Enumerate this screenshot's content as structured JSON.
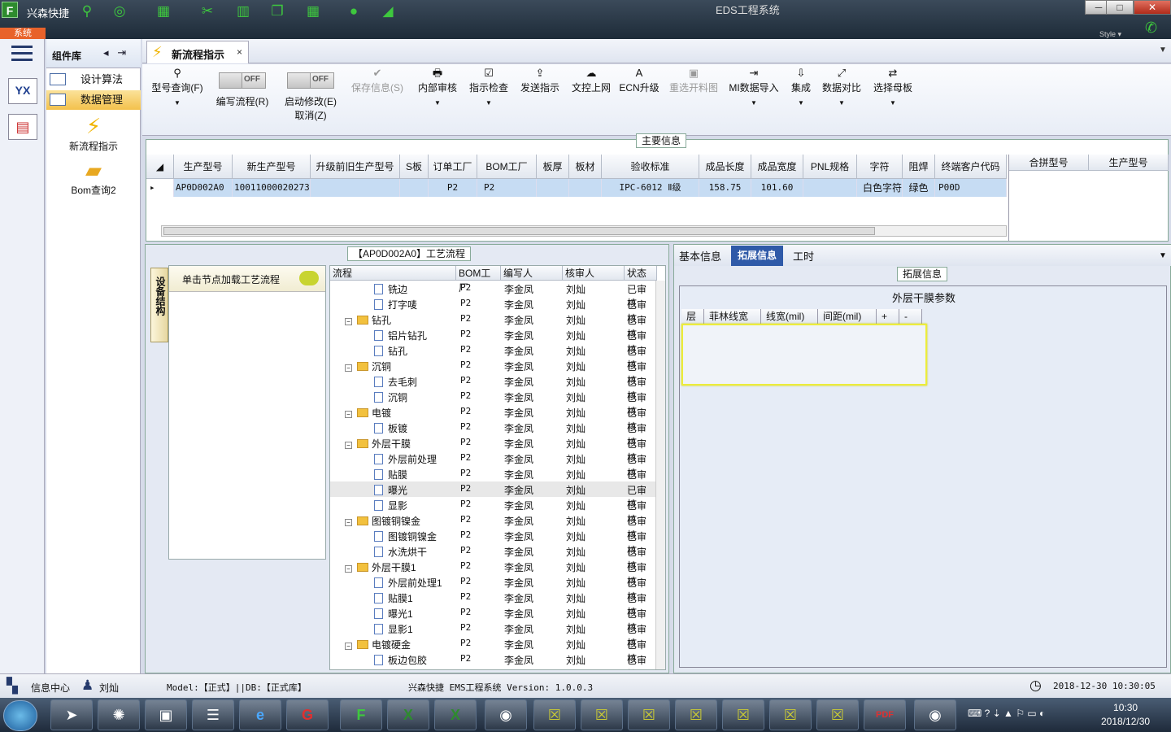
{
  "titlebar": {
    "app_name": "兴森快捷",
    "window_title": "EDS工程系统",
    "sys_tab": "系统",
    "style_label": "Style ▾",
    "min": "─",
    "max": "□",
    "close": "✕"
  },
  "complib": {
    "title": "组件库",
    "items": [
      {
        "label": "设计算法"
      },
      {
        "label": "数据管理"
      }
    ],
    "big_items": [
      {
        "label": "新流程指示"
      },
      {
        "label": "Bom查询2"
      }
    ]
  },
  "leftnav": {
    "yx_label": "YX"
  },
  "tab": {
    "label": "新流程指示",
    "close": "×"
  },
  "toolbar": {
    "buttons": [
      {
        "label": "型号查询(F)",
        "icon": "search-icon",
        "glyph": "🔍"
      },
      {
        "label": "编写流程(R)",
        "toggle": "OFF"
      },
      {
        "label": "启动修改(E)",
        "label2": "取消(Z)",
        "toggle": "OFF"
      },
      {
        "label": "保存信息(S)",
        "glyph": "✔"
      },
      {
        "label": "内部审核",
        "glyph": "🖶"
      },
      {
        "label": "指示检查",
        "glyph": "☑"
      },
      {
        "label": "发送指示",
        "glyph": "⇪"
      },
      {
        "label": "文控上网",
        "glyph": "☁"
      },
      {
        "label": "ECN升级",
        "glyph": "A"
      },
      {
        "label": "重选开料图",
        "glyph": "▣"
      },
      {
        "label": "MI数据导入",
        "glyph": "⇥"
      },
      {
        "label": "集成",
        "glyph": "⇩"
      },
      {
        "label": "数据对比",
        "glyph": "⤢"
      },
      {
        "label": "选择母板",
        "glyph": "⇄"
      }
    ]
  },
  "main_info": {
    "title": "主要信息",
    "columns": [
      "生产型号",
      "新生产型号",
      "升级前旧生产型号",
      "S板",
      "订单工厂",
      "BOM工厂",
      "板厚",
      "板材",
      "验收标准",
      "成品长度",
      "成品宽度",
      "PNL规格",
      "字符",
      "阻焊",
      "终端客户代码"
    ],
    "row": [
      "AP0D002A0",
      "10011000020273",
      "",
      "",
      "P2",
      "P2",
      "",
      "",
      "IPC-6012 Ⅱ级",
      "158.75",
      "101.60",
      "",
      "白色字符",
      "绿色",
      "P00D"
    ],
    "merge_columns": [
      "合拼型号",
      "生产型号"
    ]
  },
  "flow": {
    "title": "【AP0D002A0】工艺流程",
    "side_tab": "设备结构",
    "node_label": "单击节点加载工艺流程",
    "columns": [
      "流程",
      "BOM工厂",
      "编写人",
      "核审人",
      "状态"
    ],
    "rows": [
      {
        "name": "铣边",
        "type": "file",
        "bom": "P2",
        "writer": "李金凤",
        "reviewer": "刘灿",
        "status": "已审核"
      },
      {
        "name": "打字唛",
        "type": "file",
        "bom": "P2",
        "writer": "李金凤",
        "reviewer": "刘灿",
        "status": "已审核"
      },
      {
        "name": "钻孔",
        "type": "folder",
        "bom": "P2",
        "writer": "李金凤",
        "reviewer": "刘灿",
        "status": "已审核"
      },
      {
        "name": "铝片钻孔",
        "type": "file",
        "bom": "P2",
        "writer": "李金凤",
        "reviewer": "刘灿",
        "status": "已审核"
      },
      {
        "name": "钻孔",
        "type": "file",
        "bom": "P2",
        "writer": "李金凤",
        "reviewer": "刘灿",
        "status": "已审核"
      },
      {
        "name": "沉铜",
        "type": "folder",
        "bom": "P2",
        "writer": "李金凤",
        "reviewer": "刘灿",
        "status": "已审核"
      },
      {
        "name": "去毛刺",
        "type": "file",
        "bom": "P2",
        "writer": "李金凤",
        "reviewer": "刘灿",
        "status": "已审核"
      },
      {
        "name": "沉铜",
        "type": "file",
        "bom": "P2",
        "writer": "李金凤",
        "reviewer": "刘灿",
        "status": "已审核"
      },
      {
        "name": "电镀",
        "type": "folder",
        "bom": "P2",
        "writer": "李金凤",
        "reviewer": "刘灿",
        "status": "已审核"
      },
      {
        "name": "板镀",
        "type": "file",
        "bom": "P2",
        "writer": "李金凤",
        "reviewer": "刘灿",
        "status": "已审核"
      },
      {
        "name": "外层干膜",
        "type": "folder",
        "bom": "P2",
        "writer": "李金凤",
        "reviewer": "刘灿",
        "status": "已审核"
      },
      {
        "name": "外层前处理",
        "type": "file",
        "bom": "P2",
        "writer": "李金凤",
        "reviewer": "刘灿",
        "status": "已审核"
      },
      {
        "name": "贴膜",
        "type": "file",
        "bom": "P2",
        "writer": "李金凤",
        "reviewer": "刘灿",
        "status": "已审核"
      },
      {
        "name": "曝光",
        "type": "file",
        "bom": "P2",
        "writer": "李金凤",
        "reviewer": "刘灿",
        "status": "已审核",
        "selected": true
      },
      {
        "name": "显影",
        "type": "file",
        "bom": "P2",
        "writer": "李金凤",
        "reviewer": "刘灿",
        "status": "已审核"
      },
      {
        "name": "图镀铜镍金",
        "type": "folder",
        "bom": "P2",
        "writer": "李金凤",
        "reviewer": "刘灿",
        "status": "已审核"
      },
      {
        "name": "图镀铜镍金",
        "type": "file",
        "bom": "P2",
        "writer": "李金凤",
        "reviewer": "刘灿",
        "status": "已审核"
      },
      {
        "name": "水洗烘干",
        "type": "file",
        "bom": "P2",
        "writer": "李金凤",
        "reviewer": "刘灿",
        "status": "已审核"
      },
      {
        "name": "外层干膜1",
        "type": "folder",
        "bom": "P2",
        "writer": "李金凤",
        "reviewer": "刘灿",
        "status": "已审核"
      },
      {
        "name": "外层前处理1",
        "type": "file",
        "bom": "P2",
        "writer": "李金凤",
        "reviewer": "刘灿",
        "status": "已审核"
      },
      {
        "name": "贴膜1",
        "type": "file",
        "bom": "P2",
        "writer": "李金凤",
        "reviewer": "刘灿",
        "status": "已审核"
      },
      {
        "name": "曝光1",
        "type": "file",
        "bom": "P2",
        "writer": "李金凤",
        "reviewer": "刘灿",
        "status": "已审核"
      },
      {
        "name": "显影1",
        "type": "file",
        "bom": "P2",
        "writer": "李金凤",
        "reviewer": "刘灿",
        "status": "已审核"
      },
      {
        "name": "电镀硬金",
        "type": "folder",
        "bom": "P2",
        "writer": "李金凤",
        "reviewer": "刘灿",
        "status": "已审核"
      },
      {
        "name": "板边包胶",
        "type": "file",
        "bom": "P2",
        "writer": "李金凤",
        "reviewer": "刘灿",
        "status": "已审核"
      }
    ]
  },
  "right": {
    "tabs": [
      "基本信息",
      "拓展信息",
      "工时"
    ],
    "active_tab": "拓展信息",
    "ext_title": "拓展信息",
    "dryfilm_title": "外层干膜参数",
    "grid_columns": [
      "层",
      "菲林线宽",
      "线宽(mil)",
      "间距(mil)",
      "+",
      "-"
    ]
  },
  "status": {
    "info_center": "信息中心",
    "user": "刘灿",
    "model_db": "Model:【正式】||DB:【正式库】",
    "version": "兴森快捷 EMS工程系统 Version: 1.0.0.3",
    "datetime": "2018-12-30 10:30:05"
  },
  "taskbar": {
    "time": "10:30",
    "date": "2018/12/30"
  },
  "colors": {
    "accent": "#2f5aa8",
    "selection": "#c6dcf3",
    "highlight": "#ecec3c",
    "sys_tab": "#e8622a"
  }
}
